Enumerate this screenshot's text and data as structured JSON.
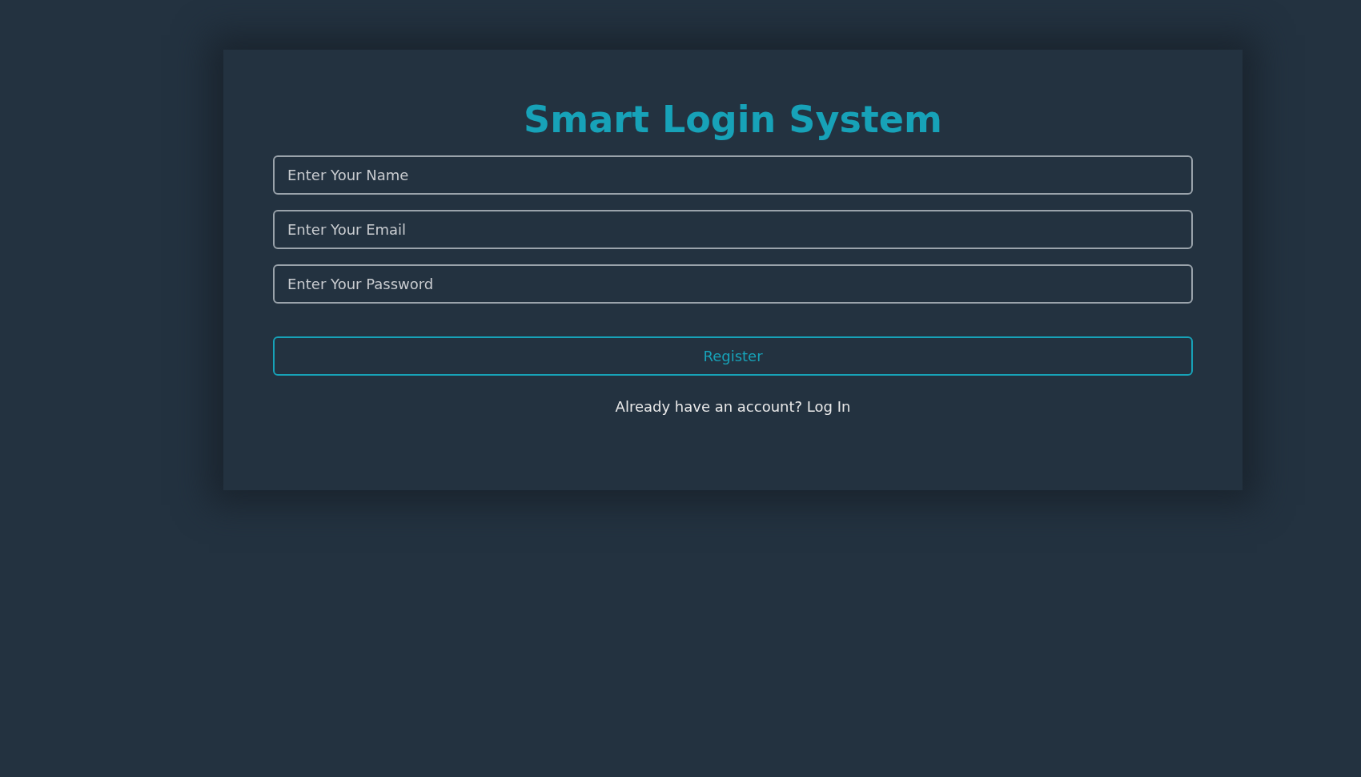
{
  "title": "Smart Login System",
  "fields": [
    {
      "placeholder": "Enter Your Name"
    },
    {
      "placeholder": "Enter Your Email"
    },
    {
      "placeholder": "Enter Your Password"
    }
  ],
  "button": "Register",
  "footer": {
    "text": "Already have an account?",
    "link": "Log In"
  }
}
